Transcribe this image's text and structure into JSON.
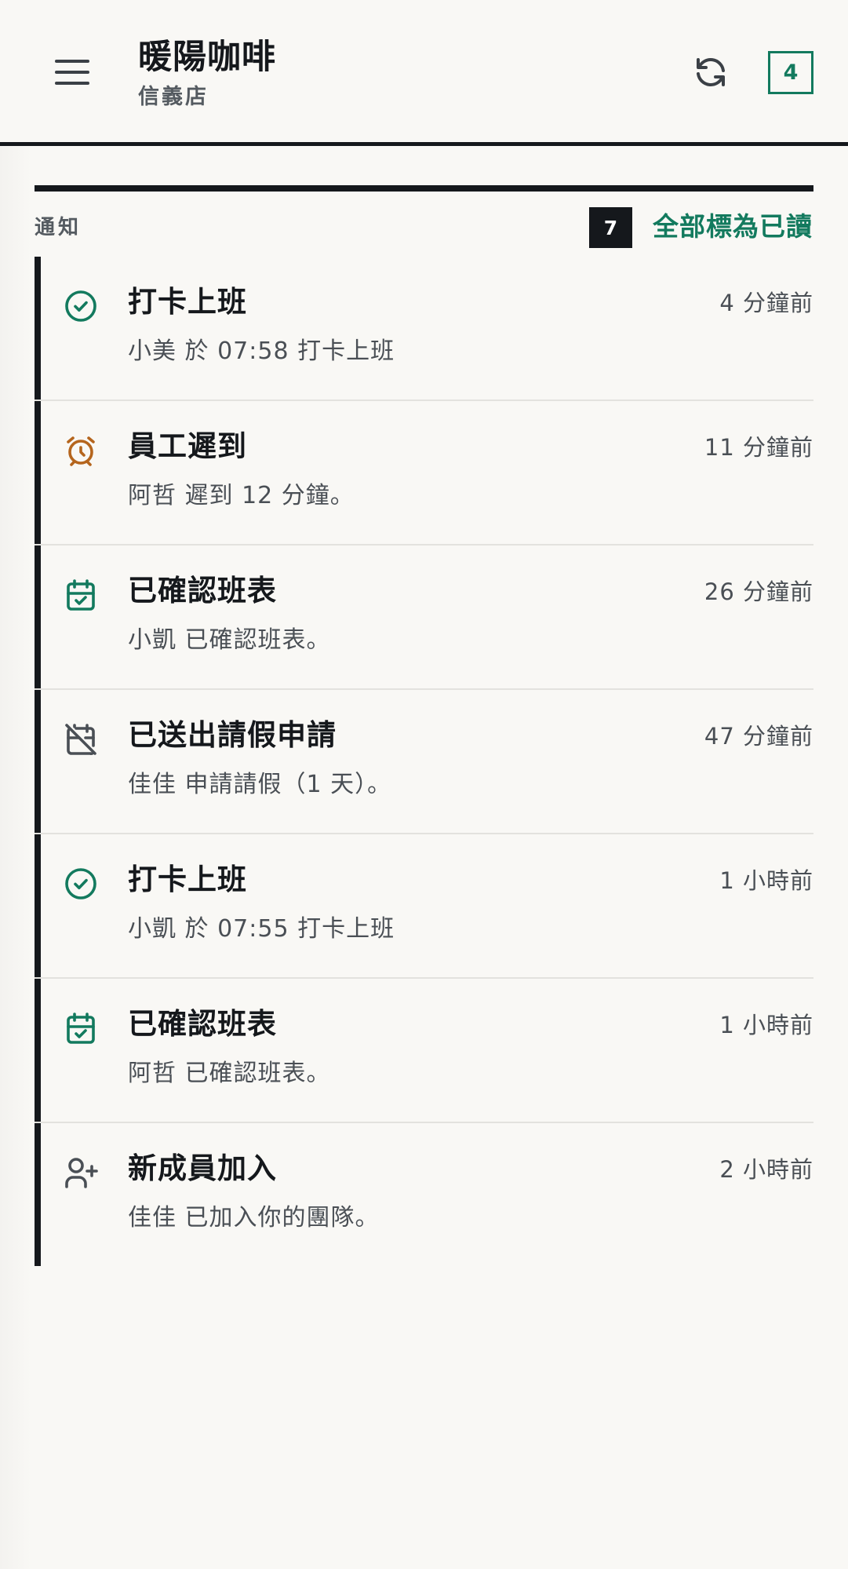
{
  "header": {
    "title": "暖陽咖啡",
    "subtitle": "信義店",
    "count_badge": "4",
    "icons": {
      "menu": "hamburger-menu-icon",
      "refresh": "refresh-icon"
    }
  },
  "section": {
    "label": "通知",
    "unread_count": "7",
    "mark_all_label": "全部標為已讀"
  },
  "colors": {
    "accent": "#137a5e",
    "warning": "#b5651d",
    "ink": "#15181c",
    "muted": "#555b61"
  },
  "notifications": [
    {
      "icon": "check-circle-icon",
      "title": "打卡上班",
      "time": "4 分鐘前",
      "body": "小美 於 07:58 打卡上班"
    },
    {
      "icon": "alarm-clock-icon",
      "title": "員工遲到",
      "time": "11 分鐘前",
      "body": "阿哲 遲到 12 分鐘。"
    },
    {
      "icon": "calendar-check-icon",
      "title": "已確認班表",
      "time": "26 分鐘前",
      "body": "小凱 已確認班表。"
    },
    {
      "icon": "calendar-off-icon",
      "title": "已送出請假申請",
      "time": "47 分鐘前",
      "body": "佳佳 申請請假（1 天）。"
    },
    {
      "icon": "check-circle-icon",
      "title": "打卡上班",
      "time": "1 小時前",
      "body": "小凱 於 07:55 打卡上班"
    },
    {
      "icon": "calendar-check-icon",
      "title": "已確認班表",
      "time": "1 小時前",
      "body": "阿哲 已確認班表。"
    },
    {
      "icon": "user-plus-icon",
      "title": "新成員加入",
      "time": "2 小時前",
      "body": "佳佳 已加入你的團隊。"
    }
  ]
}
